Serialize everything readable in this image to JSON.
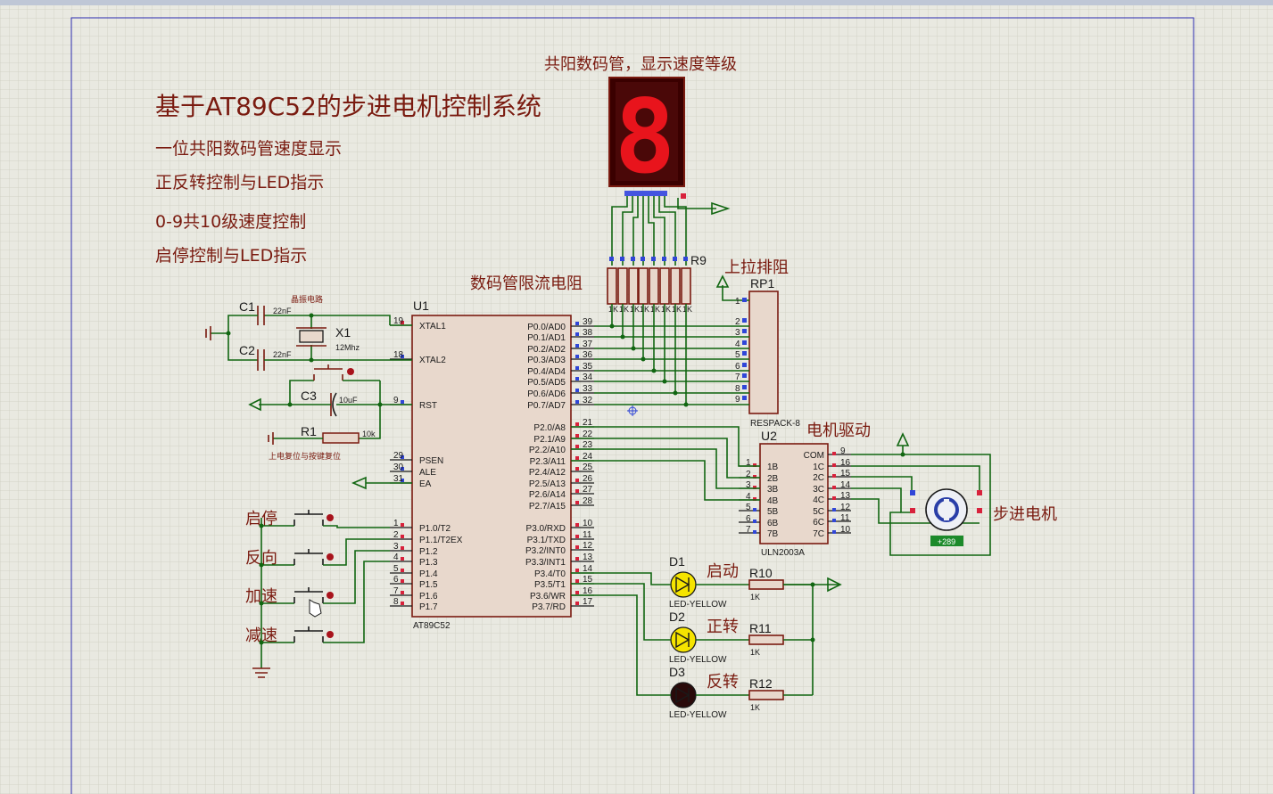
{
  "title": "基于AT89C52的步进电机控制系统",
  "features": [
    "一位共阳数码管速度显示",
    "正反转控制与LED指示",
    "0-9共10级速度控制",
    "启停控制与LED指示"
  ],
  "display_label": "共阳数码管，显示速度等级",
  "display_digit": "8",
  "resistor_label": "数码管限流电阻",
  "resistor_ref": "R9",
  "resistor_value": "1K",
  "pullup_label": "上拉排阻",
  "rp1": {
    "ref": "RP1",
    "part": "RESPACK-8"
  },
  "mcu": {
    "ref": "U1",
    "part": "AT89C52",
    "left_pins": [
      {
        "num": "19",
        "name": "XTAL1"
      },
      {
        "num": "18",
        "name": "XTAL2"
      },
      {
        "num": "9",
        "name": "RST"
      },
      {
        "num": "29",
        "name": "PSEN"
      },
      {
        "num": "30",
        "name": "ALE"
      },
      {
        "num": "31",
        "name": "EA"
      },
      {
        "num": "1",
        "name": "P1.0/T2"
      },
      {
        "num": "2",
        "name": "P1.1/T2EX"
      },
      {
        "num": "3",
        "name": "P1.2"
      },
      {
        "num": "4",
        "name": "P1.3"
      },
      {
        "num": "5",
        "name": "P1.4"
      },
      {
        "num": "6",
        "name": "P1.5"
      },
      {
        "num": "7",
        "name": "P1.6"
      },
      {
        "num": "8",
        "name": "P1.7"
      }
    ],
    "right_pins": [
      {
        "num": "39",
        "name": "P0.0/AD0"
      },
      {
        "num": "38",
        "name": "P0.1/AD1"
      },
      {
        "num": "37",
        "name": "P0.2/AD2"
      },
      {
        "num": "36",
        "name": "P0.3/AD3"
      },
      {
        "num": "35",
        "name": "P0.4/AD4"
      },
      {
        "num": "34",
        "name": "P0.5/AD5"
      },
      {
        "num": "33",
        "name": "P0.6/AD6"
      },
      {
        "num": "32",
        "name": "P0.7/AD7"
      },
      {
        "num": "21",
        "name": "P2.0/A8"
      },
      {
        "num": "22",
        "name": "P2.1/A9"
      },
      {
        "num": "23",
        "name": "P2.2/A10"
      },
      {
        "num": "24",
        "name": "P2.3/A11"
      },
      {
        "num": "25",
        "name": "P2.4/A12"
      },
      {
        "num": "26",
        "name": "P2.5/A13"
      },
      {
        "num": "27",
        "name": "P2.6/A14"
      },
      {
        "num": "28",
        "name": "P2.7/A15"
      },
      {
        "num": "10",
        "name": "P3.0/RXD"
      },
      {
        "num": "11",
        "name": "P3.1/TXD"
      },
      {
        "num": "12",
        "name": "P3.2/INT0"
      },
      {
        "num": "13",
        "name": "P3.3/INT1"
      },
      {
        "num": "14",
        "name": "P3.4/T0"
      },
      {
        "num": "15",
        "name": "P3.5/T1"
      },
      {
        "num": "16",
        "name": "P3.6/WR"
      },
      {
        "num": "17",
        "name": "P3.7/RD"
      }
    ]
  },
  "oscillator": {
    "label": "晶振电路",
    "c1": "C1",
    "c2": "C2",
    "cap": "22nF",
    "x1": "X1",
    "freq": "12Mhz"
  },
  "reset": {
    "c3": "C3",
    "c3_value": "10uF",
    "r1": "R1",
    "r1_value": "10k",
    "label": "上电复位与按键复位"
  },
  "buttons": [
    "启停",
    "反向",
    "加速",
    "减速"
  ],
  "driver": {
    "label": "电机驱动",
    "ref": "U2",
    "part": "ULN2003A",
    "left_pins": [
      {
        "num": "1",
        "name": "1B"
      },
      {
        "num": "2",
        "name": "2B"
      },
      {
        "num": "3",
        "name": "3B"
      },
      {
        "num": "4",
        "name": "4B"
      },
      {
        "num": "5",
        "name": "5B"
      },
      {
        "num": "6",
        "name": "6B"
      },
      {
        "num": "7",
        "name": "7B"
      }
    ],
    "right_pins": [
      {
        "num": "9",
        "name": "COM"
      },
      {
        "num": "16",
        "name": "1C"
      },
      {
        "num": "15",
        "name": "2C"
      },
      {
        "num": "14",
        "name": "3C"
      },
      {
        "num": "13",
        "name": "4C"
      },
      {
        "num": "12",
        "name": "5C"
      },
      {
        "num": "11",
        "name": "6C"
      },
      {
        "num": "10",
        "name": "7C"
      }
    ]
  },
  "motor": {
    "label": "步进电机",
    "readout": "+289"
  },
  "leds": [
    {
      "ref": "D1",
      "part": "LED-YELLOW",
      "label": "启动",
      "r": "R10",
      "value": "1K",
      "lit": true
    },
    {
      "ref": "D2",
      "part": "LED-YELLOW",
      "label": "正转",
      "r": "R11",
      "value": "1K",
      "lit": true
    },
    {
      "ref": "D3",
      "part": "LED-YELLOW",
      "label": "反转",
      "r": "R12",
      "value": "1K",
      "lit": false
    }
  ],
  "colors": {
    "wire": "#116611",
    "part_outline": "#7a1b10",
    "part_fill": "#e8d8cc",
    "grid": "#d4d4c8",
    "background": "#e9e9e1",
    "led_on": "#f5e400",
    "segment_on": "#e8141c"
  }
}
